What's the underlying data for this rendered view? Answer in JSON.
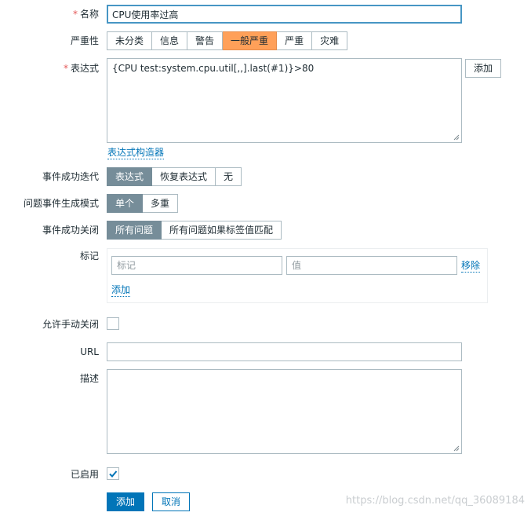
{
  "form": {
    "name": {
      "label": "名称",
      "value": "CPU使用率过高"
    },
    "severity": {
      "label": "严重性",
      "options": [
        "未分类",
        "信息",
        "警告",
        "一般严重",
        "严重",
        "灾难"
      ],
      "selected": "一般严重"
    },
    "expression": {
      "label": "表达式",
      "value": "{CPU test:system.cpu.util[,,].last(#1)}>80",
      "add_label": "添加",
      "constructor_link": "表达式构造器"
    },
    "ok_event": {
      "label": "事件成功迭代",
      "options": [
        "表达式",
        "恢复表达式",
        "无"
      ],
      "selected": "表达式"
    },
    "problem_mode": {
      "label": "问题事件生成模式",
      "options": [
        "单个",
        "多重"
      ],
      "selected": "单个"
    },
    "ok_close": {
      "label": "事件成功关闭",
      "options": [
        "所有问题",
        "所有问题如果标签值匹配"
      ],
      "selected": "所有问题"
    },
    "tags": {
      "label": "标记",
      "tag_placeholder": "标记",
      "value_placeholder": "值",
      "remove_label": "移除",
      "add_label": "添加"
    },
    "manual_close": {
      "label": "允许手动关闭",
      "checked": false
    },
    "url": {
      "label": "URL",
      "value": ""
    },
    "description": {
      "label": "描述",
      "value": ""
    },
    "enabled": {
      "label": "已启用",
      "checked": true
    }
  },
  "actions": {
    "add": "添加",
    "cancel": "取消"
  },
  "watermark": "https://blog.csdn.net/qq_36089184",
  "colors": {
    "selected_segment": "#768d99",
    "severity_average": "#ffa059",
    "primary": "#0275b8",
    "required": "#e45959"
  }
}
